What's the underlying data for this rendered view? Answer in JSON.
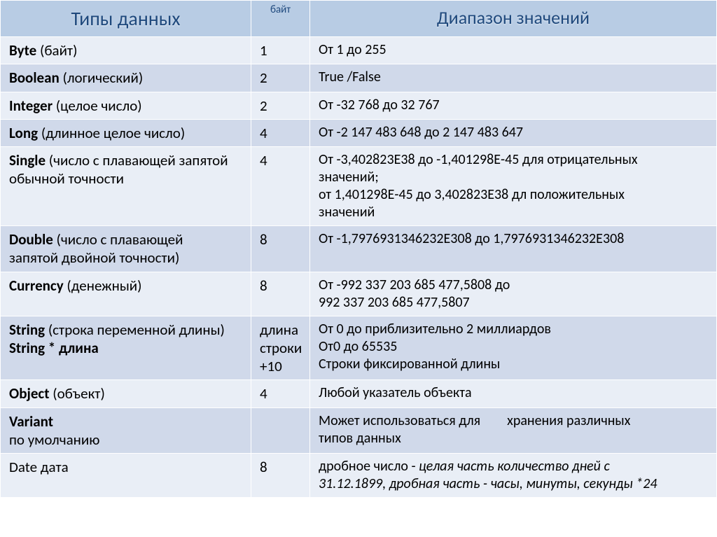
{
  "headers": {
    "types": "Типы данных",
    "bytes": "байт",
    "range": "Диапазон значений"
  },
  "rows": [
    {
      "name": "Byte",
      "paren": "(байт)",
      "line2": "",
      "bytes": "1",
      "range": "От 1 до 255",
      "range2": "",
      "range3": "",
      "range4": ""
    },
    {
      "name": "Boolean",
      "paren": "(логический)",
      "line2": "",
      "bytes": "2",
      "range": "True /False",
      "range2": "",
      "range3": "",
      "range4": ""
    },
    {
      "name": "Integer",
      "paren": "(целое число)",
      "line2": "",
      "bytes": "2",
      "range": "От -32 768 до 32 767",
      "range2": "",
      "range3": "",
      "range4": ""
    },
    {
      "name": "Long",
      "paren": "(длинное целое число)",
      "line2": "",
      "bytes": "4",
      "range": "От -2 147 483 648 до 2 147 483 647",
      "range2": "",
      "range3": "",
      "range4": ""
    },
    {
      "name": "Single",
      "paren": "(число с плавающей запятой",
      "line2": "обычной точности",
      "bytes": "4",
      "range": "От -3,402823Е38 до -1,401298Е-45 для отрицательных",
      "range2": "значений;",
      "range3": "от 1,401298Е-45 до 3,402823Е38 дл положительных",
      "range4": "значений"
    },
    {
      "name": "Double",
      "paren": "(число с плавающей",
      "line2": "запятой двойной точности)",
      "bytes": "8",
      "range": "От -1,7976931346232Е308 до 1,7976931346232Е308",
      "range2": "",
      "range3": "",
      "range4": ""
    },
    {
      "name": "Currency",
      "paren": "(денежный)",
      "line2": "",
      "bytes": "8",
      "range": "От -992 337 203 685 477,5808 до",
      "range2": "992 337 203 685 477,5807",
      "range3": "",
      "range4": ""
    },
    {
      "name": "String",
      "paren": "(строка переменной длины)",
      "line2b": "String * длина",
      "line2": "",
      "bytes": "длина строки +10",
      "range": "От 0 до приблизительно 2 миллиардов",
      "range2": "От0 до 65535",
      "range3": "Строки фиксированной длины",
      "range4": ""
    },
    {
      "name": "Object",
      "paren": "(объект)",
      "line2": "",
      "bytes": "4",
      "range": "Любой указатель объекта",
      "range2": "",
      "range3": "",
      "range4": ""
    },
    {
      "name": "Variant",
      "paren": "",
      "line2": "по умолчанию",
      "bytes": "",
      "range_pre": "Может использоваться для",
      "range_post": "хранения различных",
      "range2": "типов данных",
      "range3": "",
      "range4": ""
    },
    {
      "name": "Date",
      "post": "  дата",
      "paren": "",
      "line2": "",
      "bytes": "8",
      "range": "дробное число - ",
      "range_it1": "целая часть количество дней с",
      "range_it2": "31.12.1899, дробная часть - часы, минуты, секунды *24",
      "range2": "",
      "range3": "",
      "range4": ""
    }
  ]
}
